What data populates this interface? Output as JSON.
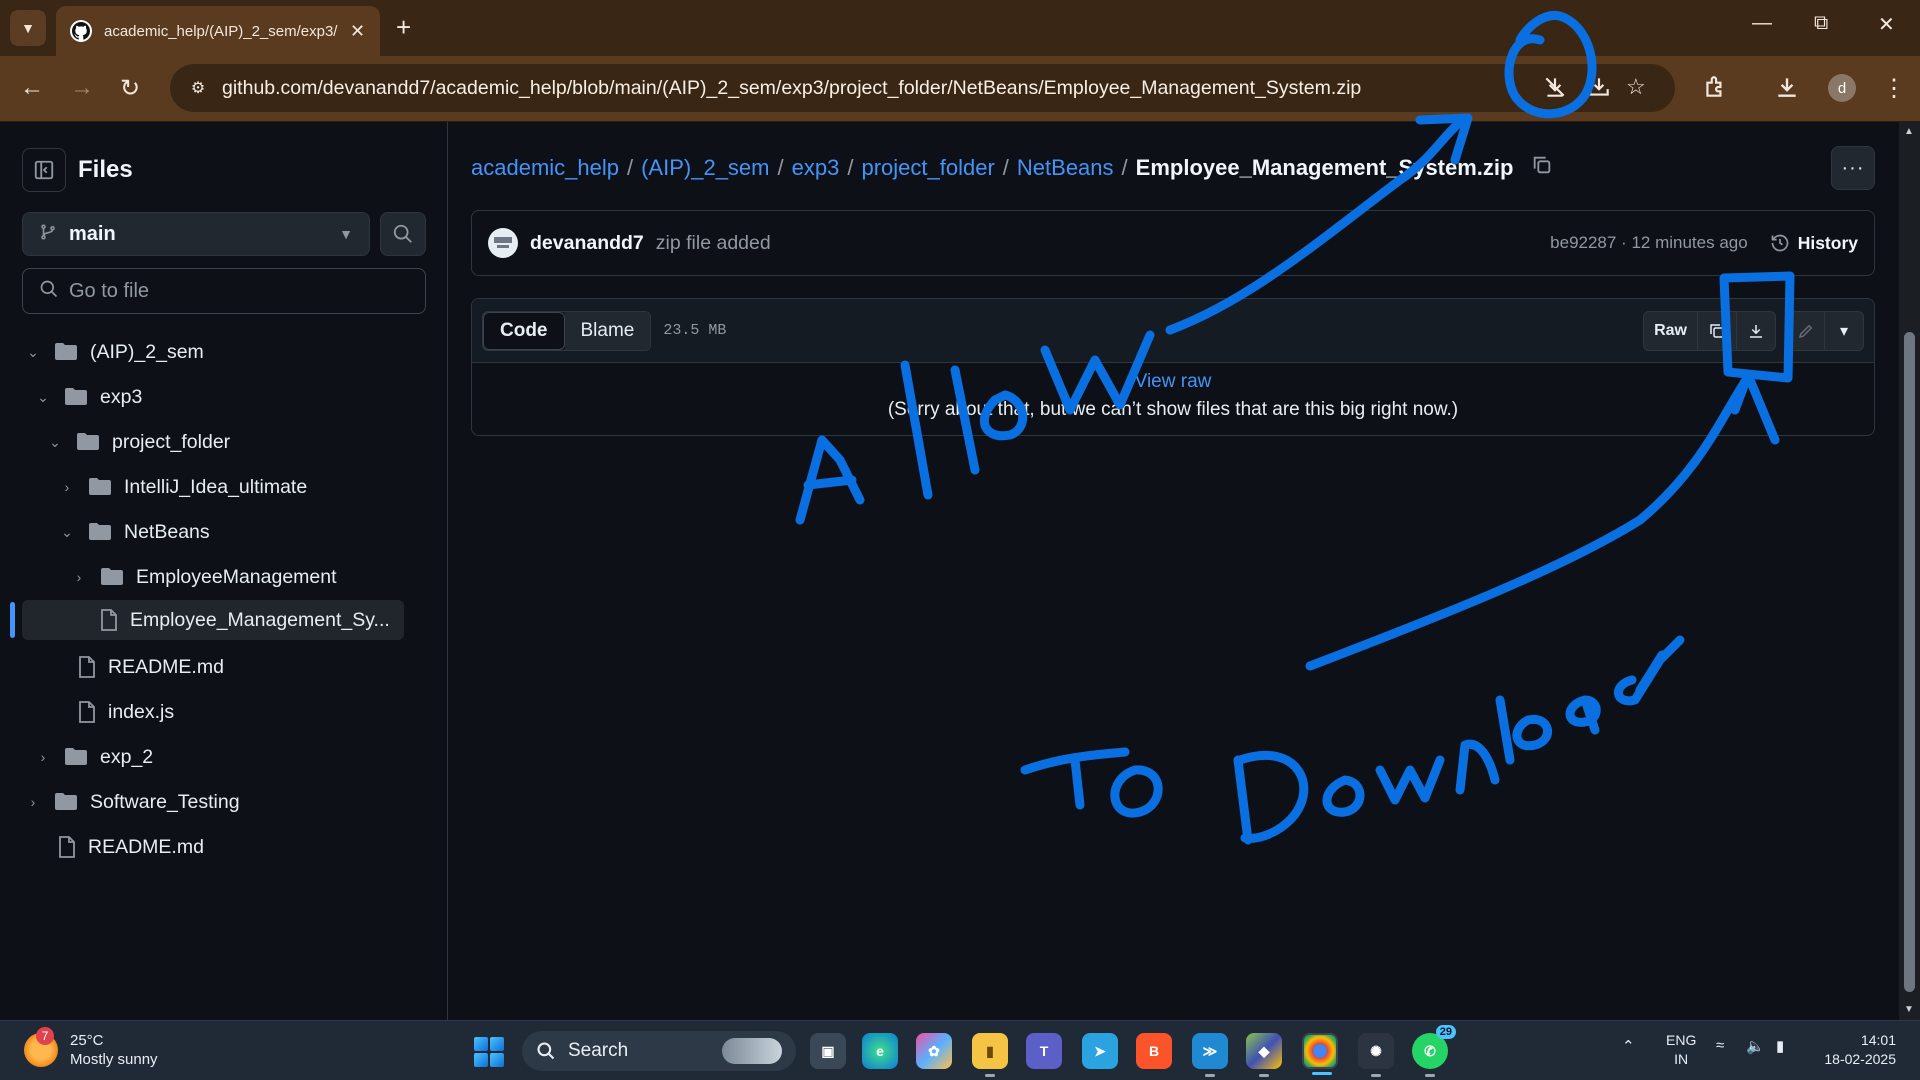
{
  "browser": {
    "tab_title": "academic_help/(AIP)_2_sem/exp3/",
    "url": "github.com/devanandd7/academic_help/blob/main/(AIP)_2_sem/exp3/project_folder/NetBeans/Employee_Management_System.zip",
    "profile_initial": "d"
  },
  "sidebar": {
    "title": "Files",
    "branch": "main",
    "goto_placeholder": "Go to file",
    "tree": [
      {
        "label": "(AIP)_2_sem",
        "type": "folder",
        "expanded": true
      },
      {
        "label": "exp3",
        "type": "folder",
        "expanded": true
      },
      {
        "label": "project_folder",
        "type": "folder",
        "expanded": true
      },
      {
        "label": "IntelliJ_Idea_ultimate",
        "type": "folder",
        "expanded": false
      },
      {
        "label": "NetBeans",
        "type": "folder",
        "expanded": true
      },
      {
        "label": "EmployeeManagement",
        "type": "folder",
        "expanded": false
      },
      {
        "label": "Employee_Management_Sy...",
        "type": "file",
        "selected": true
      },
      {
        "label": "README.md",
        "type": "file"
      },
      {
        "label": "index.js",
        "type": "file"
      },
      {
        "label": "exp_2",
        "type": "folder",
        "expanded": false
      },
      {
        "label": "Software_Testing",
        "type": "folder",
        "expanded": false
      },
      {
        "label": "README.md",
        "type": "file"
      }
    ]
  },
  "breadcrumb": {
    "parts": [
      "academic_help",
      "(AIP)_2_sem",
      "exp3",
      "project_folder",
      "NetBeans"
    ],
    "current": "Employee_Management_System.zip"
  },
  "commit": {
    "author": "devanandd7",
    "message": "zip file added",
    "meta": "be92287 · 12 minutes ago",
    "history_label": "History"
  },
  "file": {
    "tab_code": "Code",
    "tab_blame": "Blame",
    "size": "23.5 MB",
    "raw_label": "Raw",
    "view_raw": "View raw",
    "too_big": "(Sorry about that, but we can’t show files that are this big right now.)"
  },
  "annotations": {
    "allow": "Allow",
    "to_download": "To Download",
    "color": "#0a6fe0"
  },
  "taskbar": {
    "weather_temp": "25°C",
    "weather_desc": "Mostly sunny",
    "weather_badge": "7",
    "search_label": "Search",
    "whatsapp_badge": "29",
    "lang_line1": "ENG",
    "lang_line2": "IN",
    "time": "14:01",
    "date": "18-02-2025"
  }
}
